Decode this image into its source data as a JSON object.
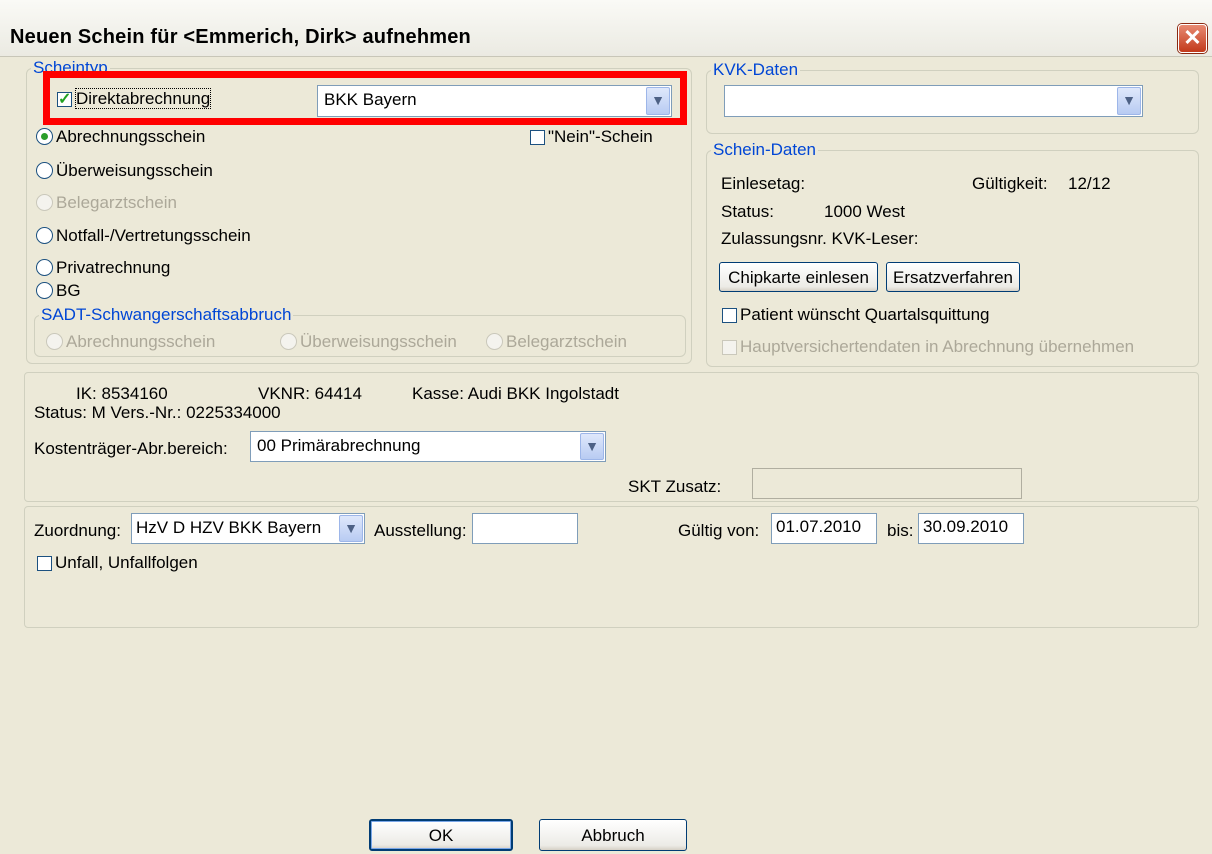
{
  "window": {
    "title": "Neuen Schein für <Emmerich, Dirk> aufnehmen",
    "close_glyph": "✕"
  },
  "scheintyp": {
    "legend": "Scheintyp",
    "direkt_label": "Direktabrechnung",
    "direkt_checked": true,
    "kasse_value": "BKK Bayern",
    "radios": {
      "abrechnung": "Abrechnungsschein",
      "ueberweisung": "Überweisungsschein",
      "belegarzt": "Belegarztschein",
      "notfall": "Notfall-/Vertretungsschein",
      "privat": "Privatrechnung",
      "bg": "BG"
    },
    "nein_label": "\"Nein\"-Schein",
    "sadt": {
      "legend": "SADT-Schwangerschaftsabbruch",
      "abrechnung": "Abrechnungsschein",
      "ueberweisung": "Überweisungsschein",
      "belegarzt": "Belegarztschein"
    }
  },
  "kvk": {
    "legend": "KVK-Daten",
    "value": ""
  },
  "schein_daten": {
    "legend": "Schein-Daten",
    "einlesetag_label": "Einlesetag:",
    "gueltigkeit_label": "Gültigkeit:",
    "gueltigkeit_value": "12/12",
    "status_label": "Status:",
    "status_value": "1000 West",
    "zulassung_label": "Zulassungsnr. KVK-Leser:",
    "chipkarte_button": "Chipkarte einlesen",
    "ersatz_button": "Ersatzverfahren",
    "quartal_label": "Patient wünscht Quartalsquittung",
    "haupt_label": "Hauptversichertendaten in Abrechnung übernehmen"
  },
  "versicherung": {
    "ik": "IK: 8534160",
    "vknr": "VKNR: 64414",
    "kasse": "Kasse: Audi BKK Ingolstadt",
    "status": "Status:  M  Vers.-Nr.:  0225334000",
    "kostentraeger_label": "Kostenträger-Abr.bereich:",
    "kostentraeger_value": "00  Primärabrechnung",
    "skt_label": "SKT Zusatz:",
    "skt_value": ""
  },
  "zuordnung": {
    "label": "Zuordnung:",
    "value": "HzV D  HZV BKK Bayern",
    "ausstellung_label": "Ausstellung:",
    "ausstellung_value": "",
    "gueltig_von_label": "Gültig von:",
    "gueltig_von_value": "01.07.2010",
    "bis_label": "bis:",
    "bis_value": "30.09.2010",
    "unfall_label": "Unfall, Unfallfolgen"
  },
  "buttons": {
    "ok": "OK",
    "cancel": "Abbruch"
  }
}
